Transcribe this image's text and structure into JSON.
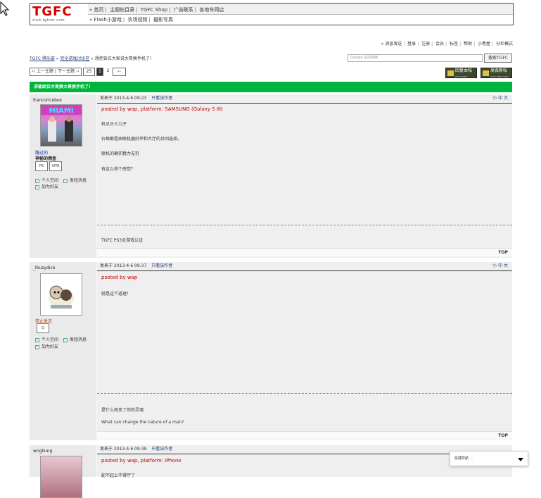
{
  "header": {
    "logo_text": "TGFC",
    "logo_sub": "club.tgfcer.com",
    "nav_row1": [
      "首页",
      "主题帖目录",
      "TGFC Shop",
      "广告联系",
      "各地车网店"
    ],
    "nav_row2": [
      "Flash小游戏",
      "农场视频",
      "摄影写真"
    ]
  },
  "toplinks": [
    "消息发送",
    "登录",
    "注册",
    "会员",
    "标签",
    "帮助",
    "小黑屋",
    "分栏模式"
  ],
  "breadcrumb": {
    "home": "TGFC 俱乐部",
    "forum": "完全游戏讨论区",
    "current": "想把各位大家说大哥换手机了！"
  },
  "search": {
    "placeholder": "Google 站内搜索",
    "button": "搜索TGFC"
  },
  "pagination": {
    "prev": "‹‹ 上一主题",
    "next": "下一主题 ››",
    "pages": [
      "25",
      "1",
      "2",
      "››"
    ]
  },
  "actions": {
    "reply": "回复本帖",
    "reply_sub": "POST REPLY",
    "new": "发表新帖",
    "new_sub": "POST NEW TOPIC"
  },
  "thread_title": "求能给位大哥换大哥换手机了！",
  "posts": [
    {
      "username": "francoricebox",
      "level": "路过的",
      "title": "神秘的佣金",
      "badges": [
        "PS",
        "VITA"
      ],
      "links": [
        "个人空间",
        "发短消息",
        "加为好友"
      ],
      "posted": "发表于 2013-4-6 09:23",
      "only_view": "只看该作者",
      "sizes": "小 中 大",
      "platform": "posted by wap, platform: SAMSUNG (Galaxy S III)",
      "lines": [
        "机瓜头三儿子",
        "价格都是由联机器好坏和大厅的共同选择。",
        "联机的确实魅力无穷",
        "有这么样个感觉？"
      ],
      "signature": "TGFC PS3全游戏认证",
      "top": "TOP"
    },
    {
      "username": "_lbuzydice",
      "level": "禁止发言",
      "badges": [
        "Q"
      ],
      "links": [
        "个人空间",
        "发短消息",
        "加为好友"
      ],
      "posted": "发表于 2013-4-6 09:37",
      "only_view": "只看该作者",
      "sizes": "小 中 大",
      "platform": "posted by wap",
      "lines": [
        "就是这个道理！"
      ],
      "signature": "是什么改变了你的灵魂",
      "signature2": "What can change the nature of a man?",
      "top": "TOP"
    },
    {
      "username": "wngliung",
      "posted": "发表于 2013-4-6 09:39",
      "only_view": "只看该作者",
      "platform": "posted by wap, platform: iPhone",
      "lines": [
        "配不起上不得厅了"
      ]
    }
  ],
  "float_widget": "快捷导航 ..."
}
